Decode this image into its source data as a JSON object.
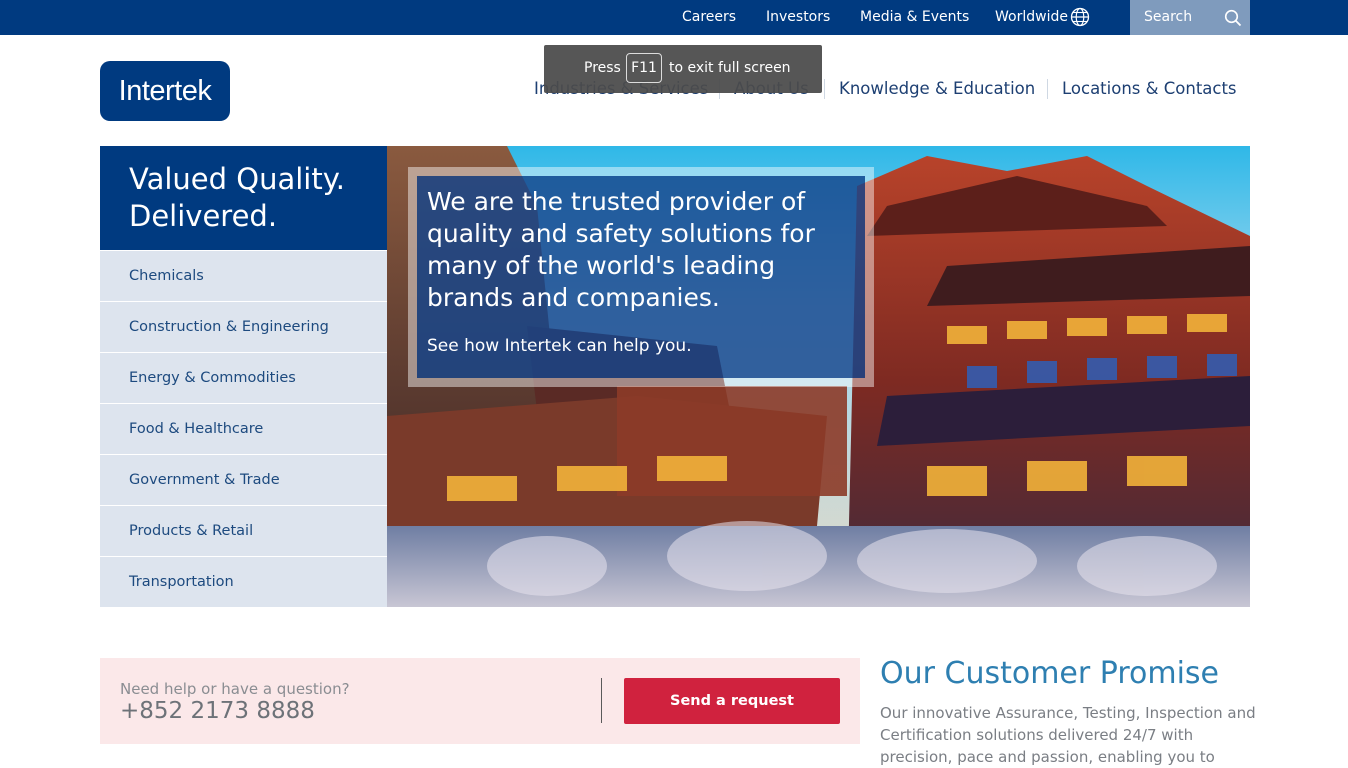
{
  "topbar": {
    "links": [
      "Careers",
      "Investors",
      "Media & Events",
      "Worldwide"
    ],
    "search_label": "Search"
  },
  "logo": {
    "text": "Intertek"
  },
  "mainnav": {
    "items": [
      "Industries & Services",
      "About Us",
      "Knowledge & Education",
      "Locations & Contacts"
    ]
  },
  "fullscreen_toast": {
    "prefix": "Press",
    "key": "F11",
    "suffix": "to exit full screen"
  },
  "tagline": {
    "line1": "Valued Quality.",
    "line2": "Delivered."
  },
  "sidenav": {
    "items": [
      "Chemicals",
      "Construction & Engineering",
      "Energy & Commodities",
      "Food & Healthcare",
      "Government & Trade",
      "Products & Retail",
      "Transportation"
    ]
  },
  "hero": {
    "headline": "We are the trusted provider of quality and safety solutions for many of the world's leading brands and companies.",
    "cta": "See how Intertek can help you."
  },
  "help": {
    "question": "Need help or have a question?",
    "phone": "+852 2173 8888",
    "button": "Send a request"
  },
  "promise": {
    "title": "Our Customer Promise",
    "text": "Our innovative Assurance, Testing, Inspection and Certification solutions delivered 24/7 with precision, pace and passion, enabling you to power"
  },
  "colors": {
    "brand_blue": "#003a80",
    "search_bg": "#7f9bbd",
    "sidenav_bg": "#dde4ee",
    "cta_red": "#d0223e",
    "help_bg": "#fbe8e9",
    "promise_title": "#2e7fb1"
  }
}
